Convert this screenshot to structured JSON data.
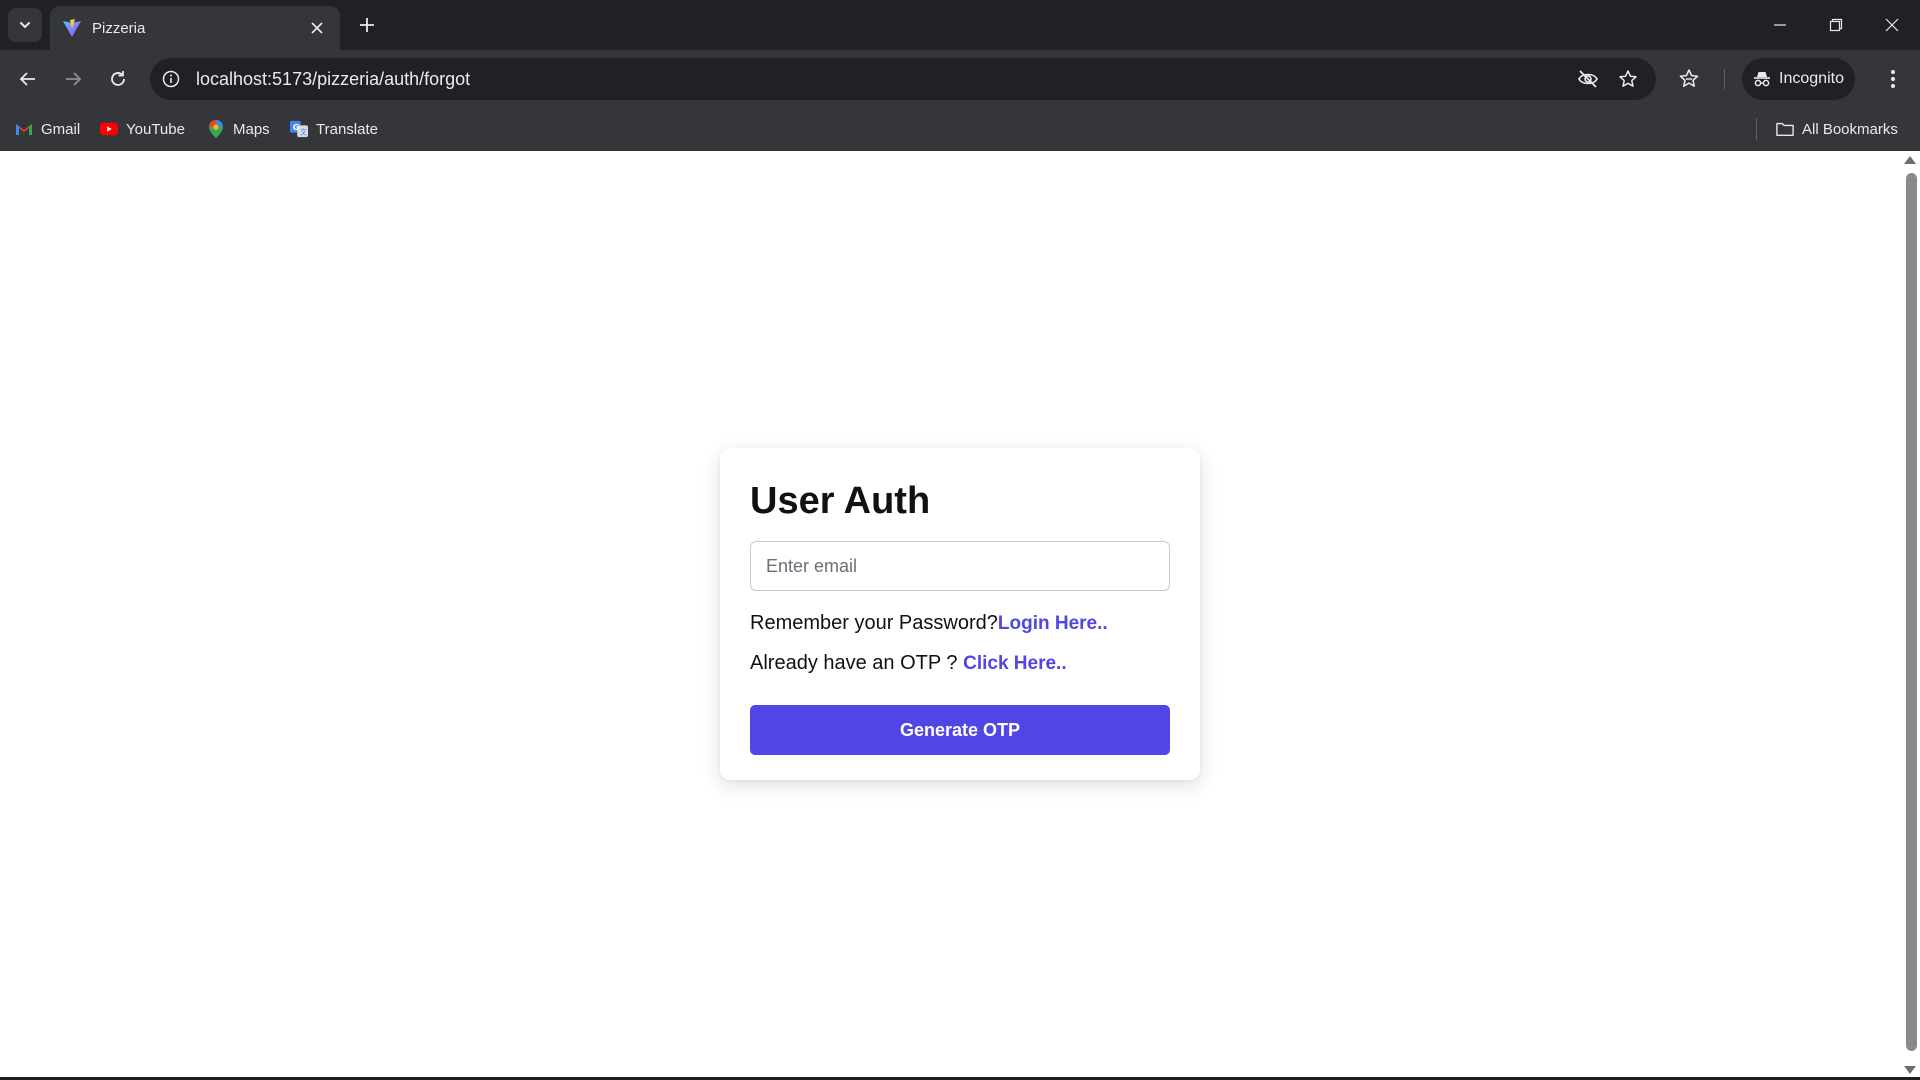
{
  "browser": {
    "tab": {
      "title": "Pizzeria",
      "favicon": "vite-icon"
    },
    "url": "localhost:5173/pizzeria/auth/forgot",
    "profile_label": "Incognito",
    "bookmarks": [
      {
        "label": "Gmail",
        "icon": "gmail-icon"
      },
      {
        "label": "YouTube",
        "icon": "youtube-icon"
      },
      {
        "label": "Maps",
        "icon": "maps-icon"
      },
      {
        "label": "Translate",
        "icon": "translate-icon"
      }
    ],
    "all_bookmarks_label": "All Bookmarks"
  },
  "page": {
    "title": "User Auth",
    "email_placeholder": "Enter email",
    "remember_text": "Remember your Password?",
    "login_link": "Login Here..",
    "otp_text": "Already have an OTP ? ",
    "otp_link": "Click Here..",
    "generate_button": "Generate OTP"
  },
  "colors": {
    "accent": "#4f46e5",
    "browser_dark": "#202124",
    "browser_toolbar": "#35363a"
  }
}
